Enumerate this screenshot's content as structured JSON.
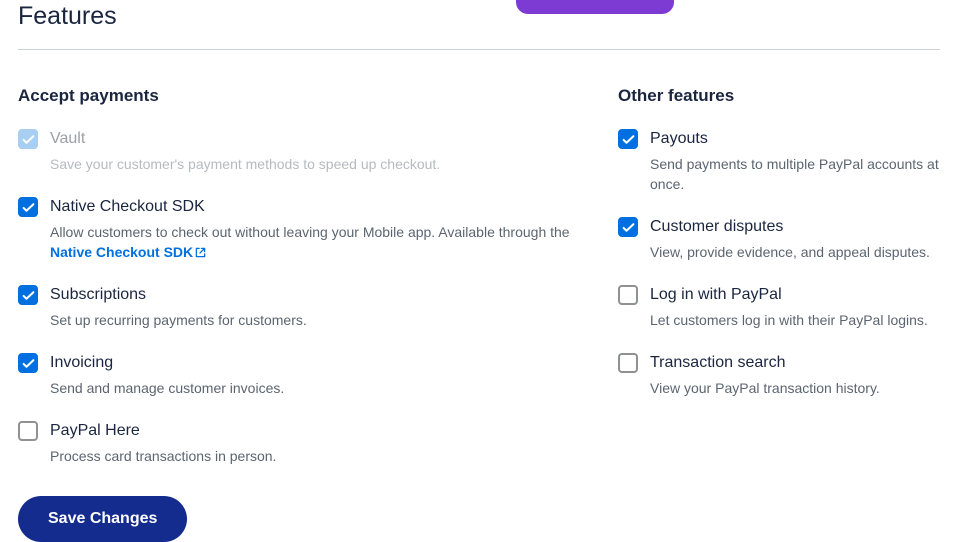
{
  "page_title": "Features",
  "sections": {
    "left": {
      "heading": "Accept payments",
      "items": [
        {
          "key": "vault",
          "title": "Vault",
          "desc": "Save your customer's payment methods to speed up checkout.",
          "state": "checked-disabled",
          "disabled": true
        },
        {
          "key": "native-checkout",
          "title": "Native Checkout SDK",
          "desc_pre": "Allow customers to check out without leaving your Mobile app. Available through the ",
          "link_text": "Native Checkout SDK",
          "state": "checked"
        },
        {
          "key": "subscriptions",
          "title": "Subscriptions",
          "desc": "Set up recurring payments for customers.",
          "state": "checked"
        },
        {
          "key": "invoicing",
          "title": "Invoicing",
          "desc": "Send and manage customer invoices.",
          "state": "checked"
        },
        {
          "key": "paypal-here",
          "title": "PayPal Here",
          "desc": "Process card transactions in person.",
          "state": "unchecked"
        }
      ]
    },
    "right": {
      "heading": "Other features",
      "items": [
        {
          "key": "payouts",
          "title": "Payouts",
          "desc": "Send payments to multiple PayPal accounts at once.",
          "state": "checked"
        },
        {
          "key": "disputes",
          "title": "Customer disputes",
          "desc": "View, provide evidence, and appeal disputes.",
          "state": "checked"
        },
        {
          "key": "login-paypal",
          "title": "Log in with PayPal",
          "desc": "Let customers log in with their PayPal logins.",
          "state": "unchecked"
        },
        {
          "key": "txn-search",
          "title": "Transaction search",
          "desc": "View your PayPal transaction history.",
          "state": "unchecked"
        }
      ]
    }
  },
  "save_button": "Save Changes"
}
